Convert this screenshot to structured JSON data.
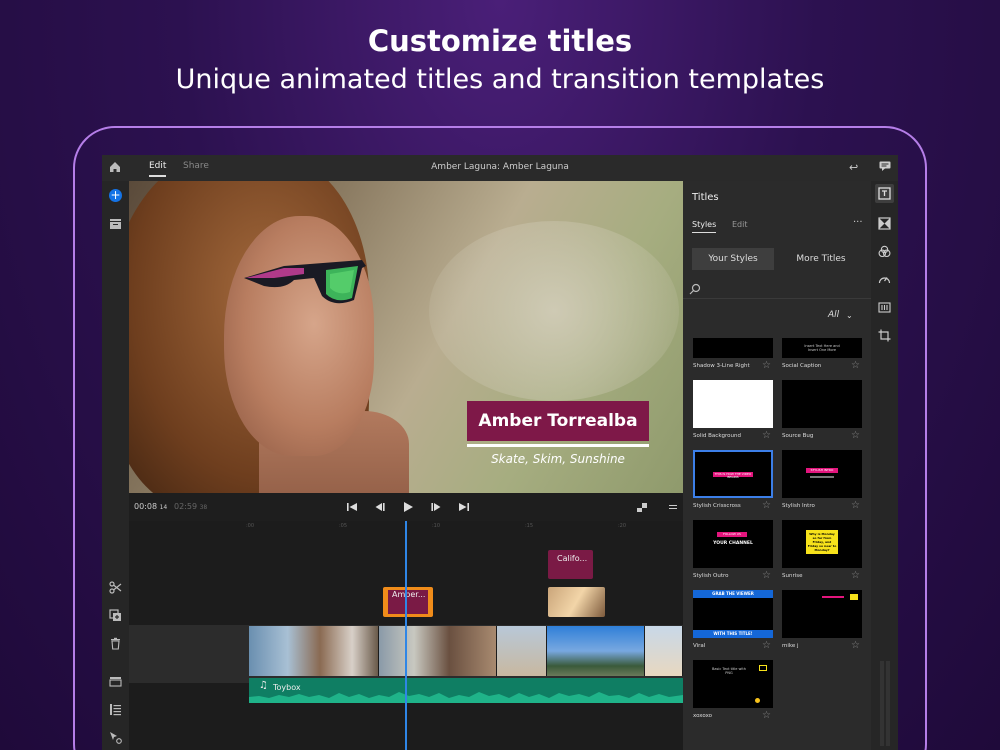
{
  "hero": {
    "title": "Customize titles",
    "subtitle": "Unique animated titles and transition templates"
  },
  "topbar": {
    "tabs": [
      {
        "label": "Edit"
      },
      {
        "label": "Share"
      }
    ],
    "project_title": "Amber Laguna: Amber Laguna"
  },
  "viewer": {
    "lower_third_name": "Amber Torrealba",
    "lower_third_tagline": "Skate, Skim, Sunshine"
  },
  "transport": {
    "current_time": "00:08",
    "current_frames": "14",
    "duration": "02:59",
    "duration_frames": "38"
  },
  "timeline": {
    "ruler": [
      ":00",
      ":05",
      ":10",
      ":15",
      ":20"
    ],
    "title_clip_1": "Califo...",
    "title_clip_2": "Amber...",
    "audio_label": "Toybox"
  },
  "panel": {
    "title": "Titles",
    "tabs": [
      {
        "label": "Styles"
      },
      {
        "label": "Edit"
      }
    ],
    "more": "···",
    "segments": [
      {
        "label": "Your Styles"
      },
      {
        "label": "More Titles"
      }
    ],
    "filter": "All",
    "tiles": [
      {
        "label": "Shadow 3-Line Right"
      },
      {
        "label": "Social Caption",
        "preview_text": "Insert Text Here and Insert One More"
      },
      {
        "label": "Solid Background"
      },
      {
        "label": "Source Bug"
      },
      {
        "label": "Stylish Crisscross",
        "preview_text": "THIS IS HOW THE VIDEO BEGINS"
      },
      {
        "label": "Stylish Intro",
        "preview_text": "STYLISH INTRO"
      },
      {
        "label": "Stylish Outro",
        "preview_text_1": "FOLLOW US",
        "preview_text_2": "YOUR CHANNEL"
      },
      {
        "label": "Sunrise",
        "preview_text": "Why is Monday so far from Friday, and Friday so near to Monday?"
      },
      {
        "label": "Viral",
        "preview_text_1": "GRAB THE VIEWER",
        "preview_text_2": "WITH THIS TITLE!"
      },
      {
        "label": "mike j"
      },
      {
        "label": "xoxoxo",
        "preview_text": "Basic Text title with PNG"
      }
    ]
  },
  "colors": {
    "accent": "#1473e6",
    "title_magenta": "#7e1848",
    "audio_green": "#0f7e63",
    "playhead": "#2f86e6",
    "amber_clip": "#f08c1a"
  }
}
